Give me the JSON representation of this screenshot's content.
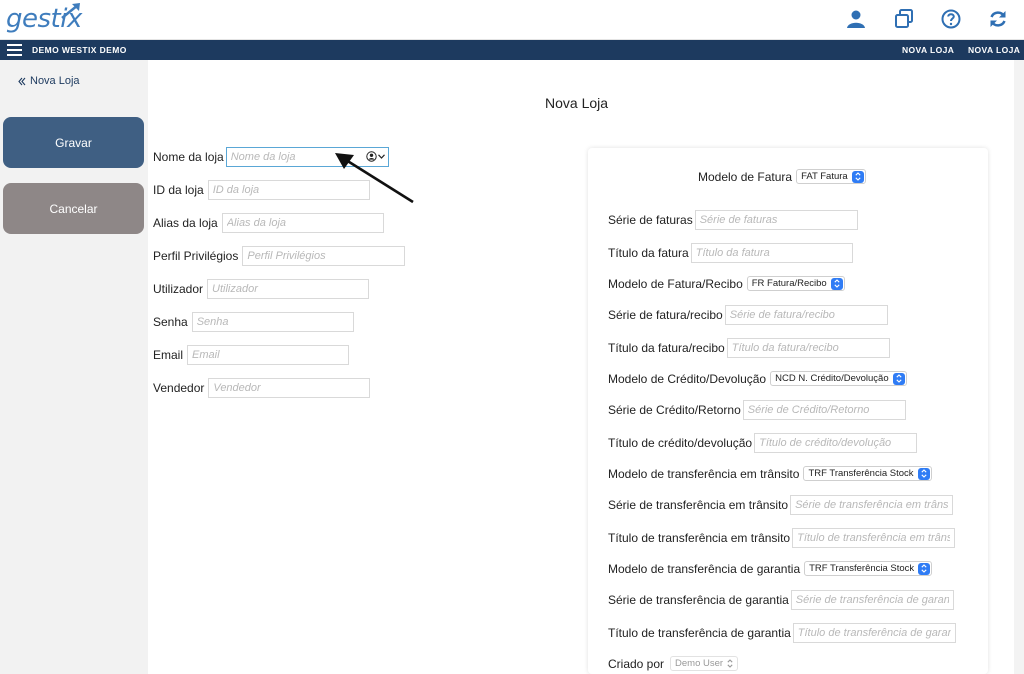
{
  "app": {
    "logo": "gestix",
    "company": "DEMO WESTIX DEMO",
    "nav_right": [
      "NOVA LOJA",
      "NOVA LOJA"
    ]
  },
  "icons": {
    "user": "user-icon",
    "windows": "duplicate-windows-icon",
    "help": "help-icon",
    "refresh": "refresh-icon",
    "menu": "hamburger-menu-icon",
    "back": "double-chevron-left-icon",
    "account": "account-circle-icon"
  },
  "colors": {
    "accent": "#1d3a5f",
    "save": "#3f5f83",
    "cancel": "#8e8787",
    "select_chevron": "#2f7cf5",
    "logo": "#3f7dbd"
  },
  "sidebar": {
    "back_label": "Nova Loja",
    "save_label": "Gravar",
    "cancel_label": "Cancelar"
  },
  "page": {
    "title": "Nova Loja"
  },
  "left_form": [
    {
      "label": "Nome da loja",
      "placeholder": "Nome da loja"
    },
    {
      "label": "ID da loja",
      "placeholder": "ID da loja"
    },
    {
      "label": "Alias da loja",
      "placeholder": "Alias da loja"
    },
    {
      "label": "Perfil Privilégios",
      "placeholder": "Perfil Privilégios"
    },
    {
      "label": "Utilizador",
      "placeholder": "Utilizador"
    },
    {
      "label": "Senha",
      "placeholder": "Senha"
    },
    {
      "label": "Email",
      "placeholder": "Email"
    },
    {
      "label": "Vendedor",
      "placeholder": "Vendedor"
    }
  ],
  "right_form": [
    {
      "label": "Modelo de Fatura",
      "value": "FAT Fatura"
    },
    {
      "label": "Série de faturas",
      "placeholder": "Série de faturas"
    },
    {
      "label": "Título da fatura",
      "placeholder": "Título da fatura"
    },
    {
      "label": "Modelo de Fatura/Recibo",
      "value": "FR Fatura/Recibo"
    },
    {
      "label": "Série de fatura/recibo",
      "placeholder": "Série de fatura/recibo"
    },
    {
      "label": "Título da fatura/recibo",
      "placeholder": "Título da fatura/recibo"
    },
    {
      "label": "Modelo de Crédito/Devolução",
      "value": "NCD N. Crédito/Devolução"
    },
    {
      "label": "Série de Crédito/Retorno",
      "placeholder": "Série de Crédito/Retorno"
    },
    {
      "label": "Título de crédito/devolução",
      "placeholder": "Título de crédito/devolução"
    },
    {
      "label": "Modelo de transferência em trânsito",
      "value": "TRF Transferência Stock"
    },
    {
      "label": "Série de transferência em trânsito",
      "placeholder": "Série de transferência em trânsito"
    },
    {
      "label": "Título de transferência em trânsito",
      "placeholder": "Título de transferência em trânsito"
    },
    {
      "label": "Modelo de transferência de garantia",
      "value": "TRF Transferência Stock"
    },
    {
      "label": "Série de transferência de garantia",
      "placeholder": "Série de transferência de garantia"
    },
    {
      "label": "Título de transferência de garantia",
      "placeholder": "Título de transferência de garantia"
    },
    {
      "label": "Criado por",
      "value": "Demo User"
    }
  ]
}
